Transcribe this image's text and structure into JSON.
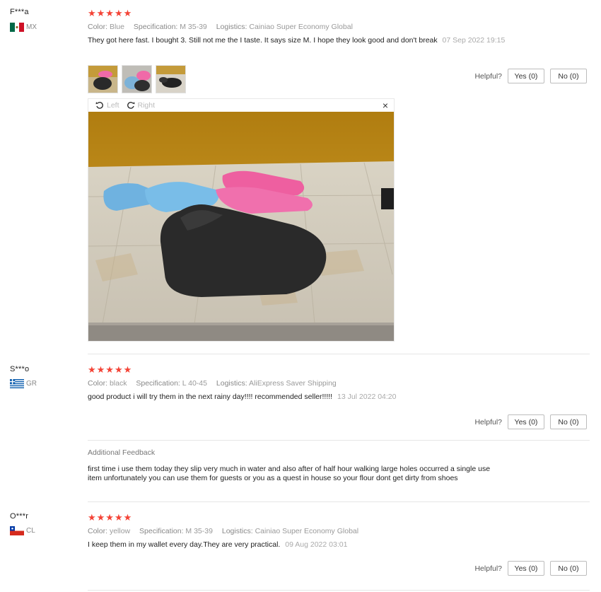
{
  "reviews": [
    {
      "user": "F***a",
      "country": "MX",
      "stars": "★★★★★",
      "color_label": "Color:",
      "color_value": "Blue",
      "spec_label": "Specification:",
      "spec_value": "M 35-39",
      "logistics_label": "Logistics:",
      "logistics_value": "Cainiao Super Economy Global",
      "text": "They got here fast. I bought 3. Still not me the I taste. It says size M. I hope they look good and don't break",
      "date": "07 Sep 2022 19:15",
      "helpful_label": "Helpful?",
      "yes_label": "Yes (0)",
      "no_label": "No (0)"
    },
    {
      "user": "S***o",
      "country": "GR",
      "stars": "★★★★★",
      "color_label": "Color:",
      "color_value": "black",
      "spec_label": "Specification:",
      "spec_value": "L 40-45",
      "logistics_label": "Logistics:",
      "logistics_value": "AliExpress Saver Shipping",
      "text": "good product i will try them in the next rainy day!!!! recommended seller!!!!!",
      "date": "13 Jul 2022 04:20",
      "helpful_label": "Helpful?",
      "yes_label": "Yes (0)",
      "no_label": "No (0)",
      "additional_label": "Additional Feedback",
      "additional_text": "first time i use them today they slip very much in water and also after of half hour walking large holes occurred a single use item unfortunately you can use them for guests or you as a quest in house so your flour dont get dirty from shoes"
    },
    {
      "user": "O***r",
      "country": "CL",
      "stars": "★★★★★",
      "color_label": "Color:",
      "color_value": "yellow",
      "spec_label": "Specification:",
      "spec_value": "M 35-39",
      "logistics_label": "Logistics:",
      "logistics_value": "Cainiao Super Economy Global",
      "text": "I keep them in my wallet every day.They are very practical.",
      "date": "09 Aug 2022 03:01",
      "helpful_label": "Helpful?",
      "yes_label": "Yes (0)",
      "no_label": "No (0)"
    }
  ],
  "viewer": {
    "left_label": "Left",
    "right_label": "Right",
    "close_symbol": "×"
  },
  "colors": {
    "star": "#f44336",
    "border": "#bdbdbd",
    "divider": "#e6e6e6"
  }
}
